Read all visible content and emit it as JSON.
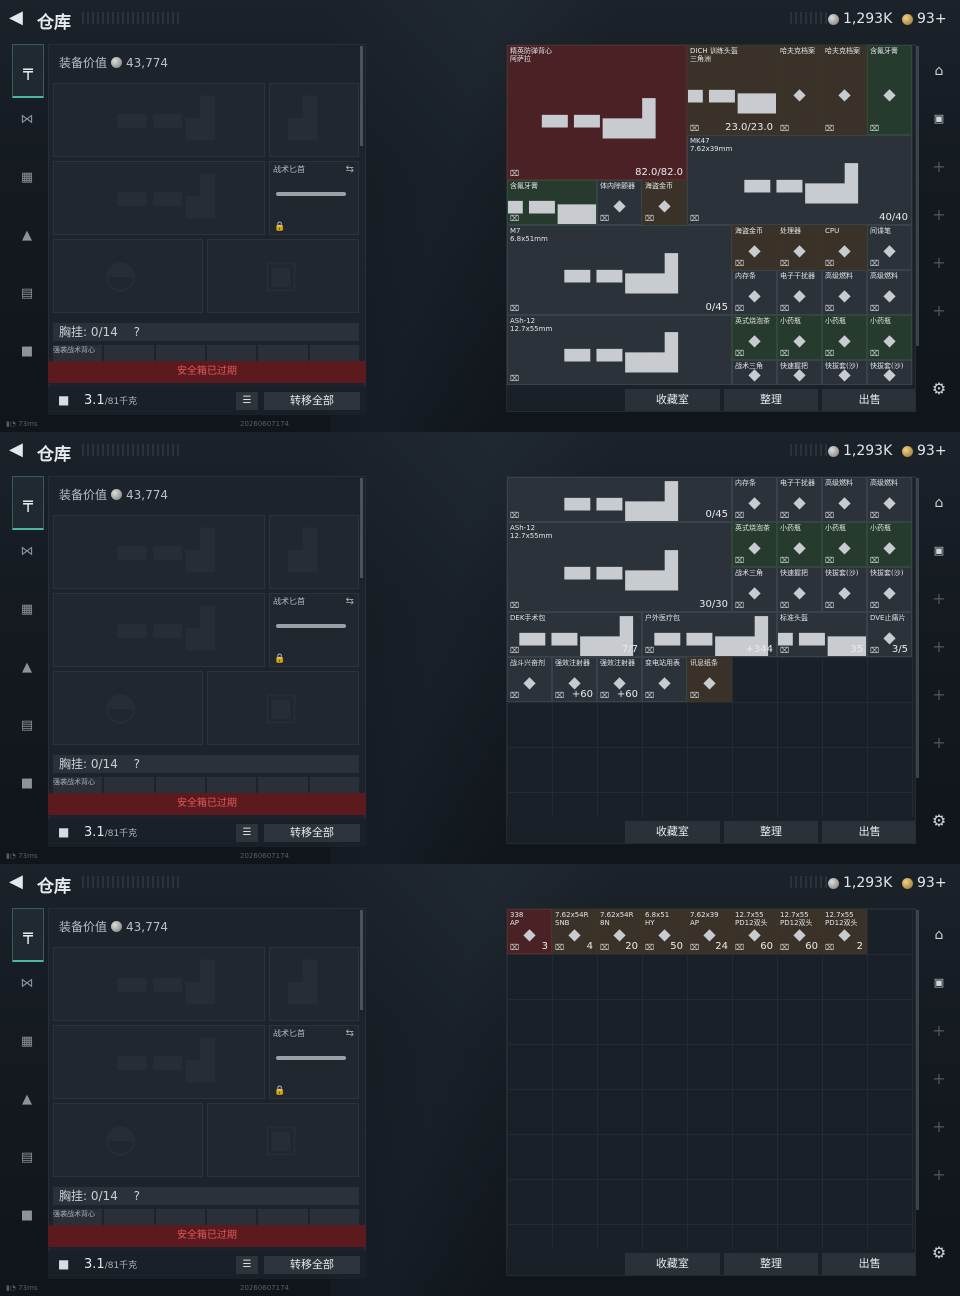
{
  "header": {
    "title": "仓库",
    "currency": "1,293K",
    "tokens": "93+"
  },
  "left": {
    "equip_label": "装备价值",
    "equip_value": "43,774",
    "knife_label": "战术匕首",
    "chest_label": "胸挂:",
    "chest_value": "0/14",
    "chest_help": "?",
    "strip_label": "强袭战术背心",
    "safebox": "安全箱已过期",
    "weight": "3.1",
    "weight_unit": "/81千克",
    "transfer": "转移全部",
    "status": "73ms",
    "build": "20260607174"
  },
  "actions": {
    "collection": "收藏室",
    "sort": "整理",
    "sell": "出售"
  },
  "panel1_items": [
    {
      "n": "精英防弹背心\n阿萨拉",
      "q": "82.0/82.0",
      "c": "r"
    },
    {
      "n": "DICH 训练头盔\n三角洲",
      "q": "23.0/23.0",
      "c": ""
    },
    {
      "n": "哈夫克档案",
      "q": "",
      "c": ""
    },
    {
      "n": "哈夫克档案",
      "q": "",
      "c": ""
    },
    {
      "n": "含氟牙膏",
      "q": "",
      "c": "g"
    },
    {
      "n": "MK47\n7.62x39mm",
      "q": "40/40",
      "c": "d"
    },
    {
      "n": "含氟牙膏",
      "q": "",
      "c": "g"
    },
    {
      "n": "体内除颤器",
      "q": "",
      "c": "d"
    },
    {
      "n": "海盗金币",
      "q": "",
      "c": ""
    },
    {
      "n": "M7\n6.8x51mm",
      "q": "0/45",
      "c": "d"
    },
    {
      "n": "海盗金币",
      "q": "",
      "c": ""
    },
    {
      "n": "处理器",
      "q": "",
      "c": ""
    },
    {
      "n": "CPU",
      "q": "",
      "c": ""
    },
    {
      "n": "间谍笔",
      "q": "",
      "c": "d"
    },
    {
      "n": "内存条",
      "q": "",
      "c": "d"
    },
    {
      "n": "电子干扰器",
      "q": "",
      "c": "d"
    },
    {
      "n": "高级燃料",
      "q": "",
      "c": "d"
    },
    {
      "n": "高级燃料",
      "q": "",
      "c": "d"
    },
    {
      "n": "ASh-12\n12.7x55mm",
      "q": "",
      "c": "d"
    },
    {
      "n": "英式烧泡茶",
      "q": "",
      "c": "g"
    },
    {
      "n": "小药瓶",
      "q": "",
      "c": "g"
    },
    {
      "n": "小药瓶",
      "q": "",
      "c": "g"
    },
    {
      "n": "小药瓶",
      "q": "",
      "c": "g"
    },
    {
      "n": "战术三角",
      "q": "",
      "c": "d"
    },
    {
      "n": "快速握把",
      "q": "",
      "c": "d"
    },
    {
      "n": "快拔套(沙)",
      "q": "",
      "c": "d"
    },
    {
      "n": "快拔套(沙)",
      "q": "",
      "c": "d"
    }
  ],
  "panel2_items": [
    {
      "n": "内存条",
      "q": "",
      "c": "d"
    },
    {
      "n": "电子干扰器",
      "q": "",
      "c": "d"
    },
    {
      "n": "高级燃料",
      "q": "",
      "c": "d"
    },
    {
      "n": "高级燃料",
      "q": "",
      "c": "d"
    },
    {
      "n": "",
      "q": "0/45",
      "c": "d"
    },
    {
      "n": "英式烧泡茶",
      "q": "",
      "c": "g"
    },
    {
      "n": "小药瓶",
      "q": "",
      "c": "g"
    },
    {
      "n": "小药瓶",
      "q": "",
      "c": "g"
    },
    {
      "n": "小药瓶",
      "q": "",
      "c": "g"
    },
    {
      "n": "ASh-12\n12.7x55mm",
      "q": "30/30",
      "c": "d"
    },
    {
      "n": "战术三角",
      "q": "",
      "c": "d"
    },
    {
      "n": "快速握把",
      "q": "",
      "c": "d"
    },
    {
      "n": "快拔套(沙)",
      "q": "",
      "c": "d"
    },
    {
      "n": "快拔套(沙)",
      "q": "",
      "c": "d"
    },
    {
      "n": "DEK手术包",
      "q": "7/7",
      "c": "d"
    },
    {
      "n": "户外医疗包",
      "q": "+344",
      "c": "d"
    },
    {
      "n": "标准头盔",
      "q": "35",
      "c": "d"
    },
    {
      "n": "DVE止痛片",
      "q": "3/5",
      "c": "d"
    },
    {
      "n": "战斗兴奋剂",
      "q": "",
      "c": "d"
    },
    {
      "n": "强效注射器",
      "q": "+60",
      "c": "d"
    },
    {
      "n": "强效注射器",
      "q": "+60",
      "c": "d"
    },
    {
      "n": "变电站用表",
      "q": "",
      "c": "d"
    },
    {
      "n": "讯息纸条",
      "q": "",
      "c": ""
    }
  ],
  "panel3_items": [
    {
      "n": "338\nAP",
      "q": "3",
      "c": "r"
    },
    {
      "n": "7.62x54R\nSNB",
      "q": "4",
      "c": ""
    },
    {
      "n": "7.62x54R\n8N",
      "q": "20",
      "c": ""
    },
    {
      "n": "6.8x51\nHY",
      "q": "50",
      "c": ""
    },
    {
      "n": "7.62x39\nAP",
      "q": "24",
      "c": ""
    },
    {
      "n": "12.7x55\nPD12双头",
      "q": "60",
      "c": ""
    },
    {
      "n": "12.7x55\nPD12双头",
      "q": "60",
      "c": ""
    },
    {
      "n": "12.7x55\nPD12双头",
      "q": "2",
      "c": ""
    }
  ]
}
